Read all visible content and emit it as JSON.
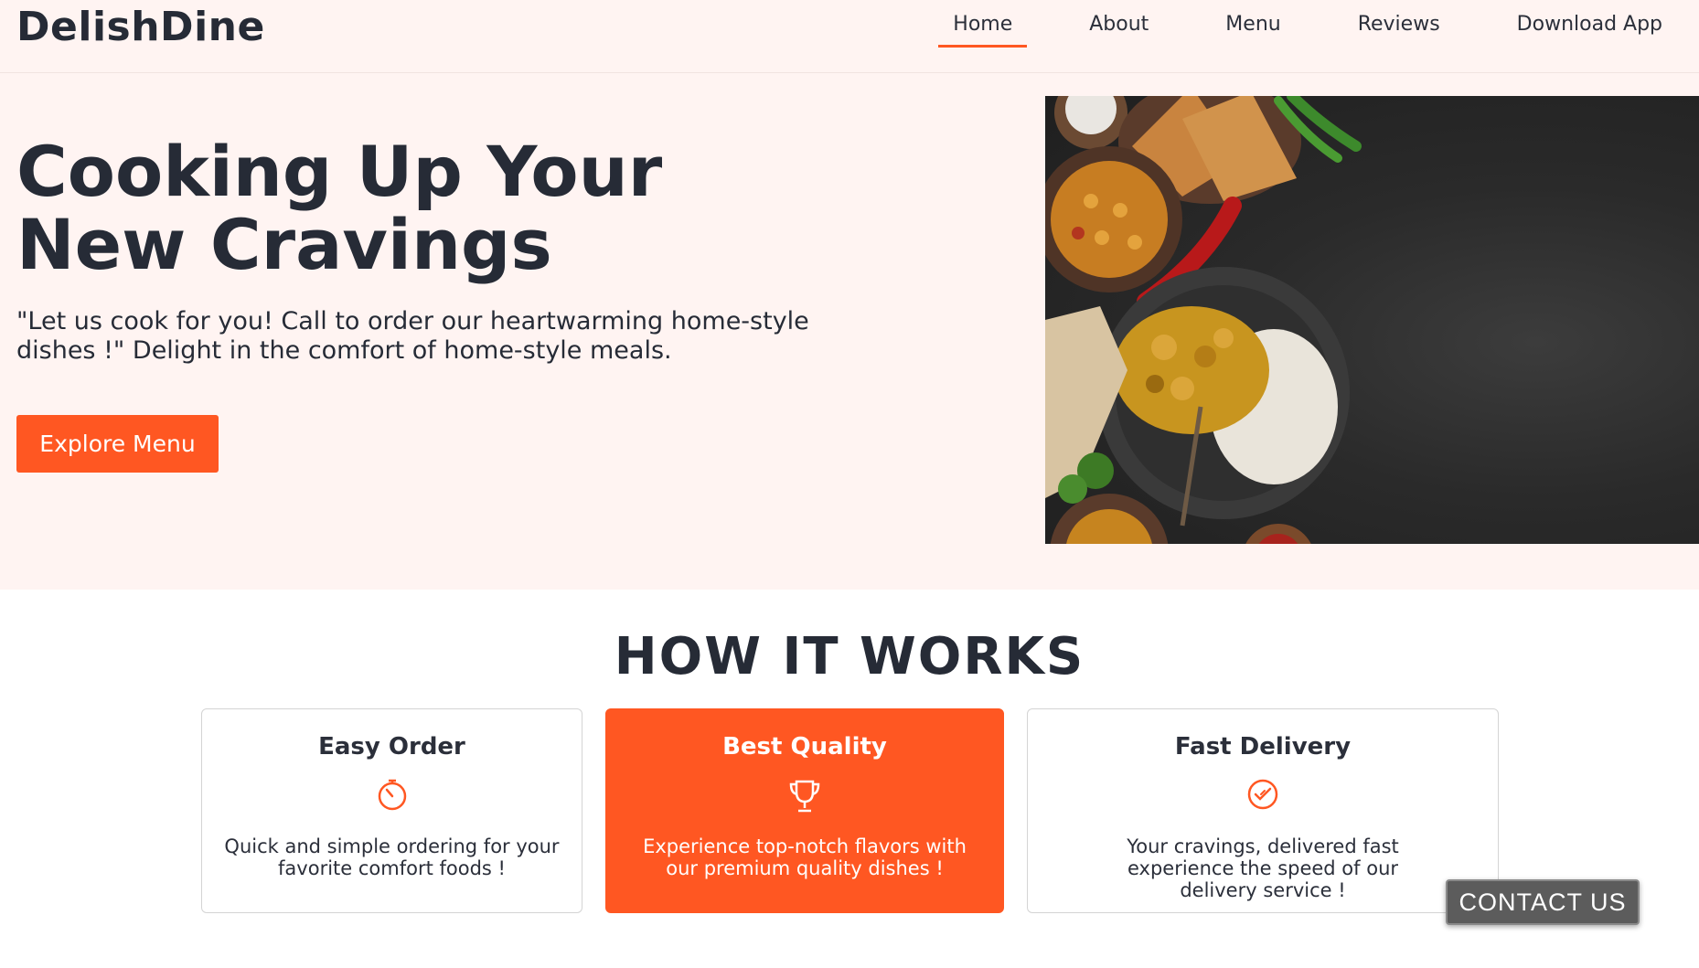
{
  "header": {
    "logo": "DelishDine",
    "nav": [
      {
        "label": "Home",
        "active": true
      },
      {
        "label": "About"
      },
      {
        "label": "Menu"
      },
      {
        "label": "Reviews"
      },
      {
        "label": "Download App"
      }
    ]
  },
  "hero": {
    "title_line1": "Cooking Up Your",
    "title_line2": "New Cravings",
    "subtitle": "\"Let us cook for you! Call to order our heartwarming home-style dishes !\" Delight in the comfort of home-style meals.",
    "cta_label": "Explore Menu",
    "image_icon": "food-photo-icon"
  },
  "how_it_works": {
    "title": "HOW IT WORKS",
    "cards": [
      {
        "title": "Easy Order",
        "icon": "stopwatch-icon",
        "text": "Quick and simple ordering for your favorite comfort foods !"
      },
      {
        "title": "Best Quality",
        "icon": "trophy-icon",
        "text": "Experience top-notch flavors with our premium quality dishes !"
      },
      {
        "title": "Fast Delivery",
        "icon": "check-badge-icon",
        "text": "Your cravings, delivered fast experience the speed of our delivery service !"
      }
    ]
  },
  "contact": {
    "label": "CONTACT US"
  },
  "colors": {
    "accent": "#ff5722",
    "hero_bg": "#fff4f2",
    "dark_text": "#262b36"
  }
}
